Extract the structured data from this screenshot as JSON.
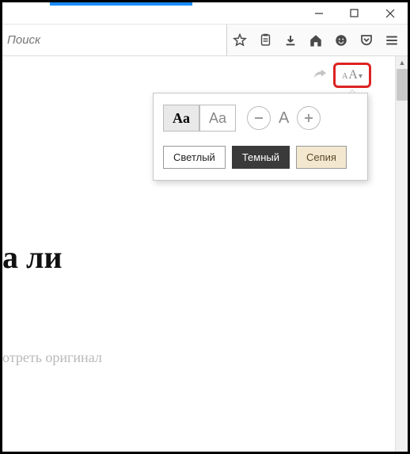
{
  "window": {
    "title_tab_accent": "#1a8cff"
  },
  "toolbar": {
    "search_placeholder": "Поиск"
  },
  "reader": {
    "font_sample": "Aa",
    "themes": {
      "light": "Светлый",
      "dark": "Темный",
      "sepia": "Сепия"
    },
    "size_mid": "A"
  },
  "page": {
    "title_fragment": "а ли",
    "subtitle_fragment": "отреть оригинал"
  }
}
